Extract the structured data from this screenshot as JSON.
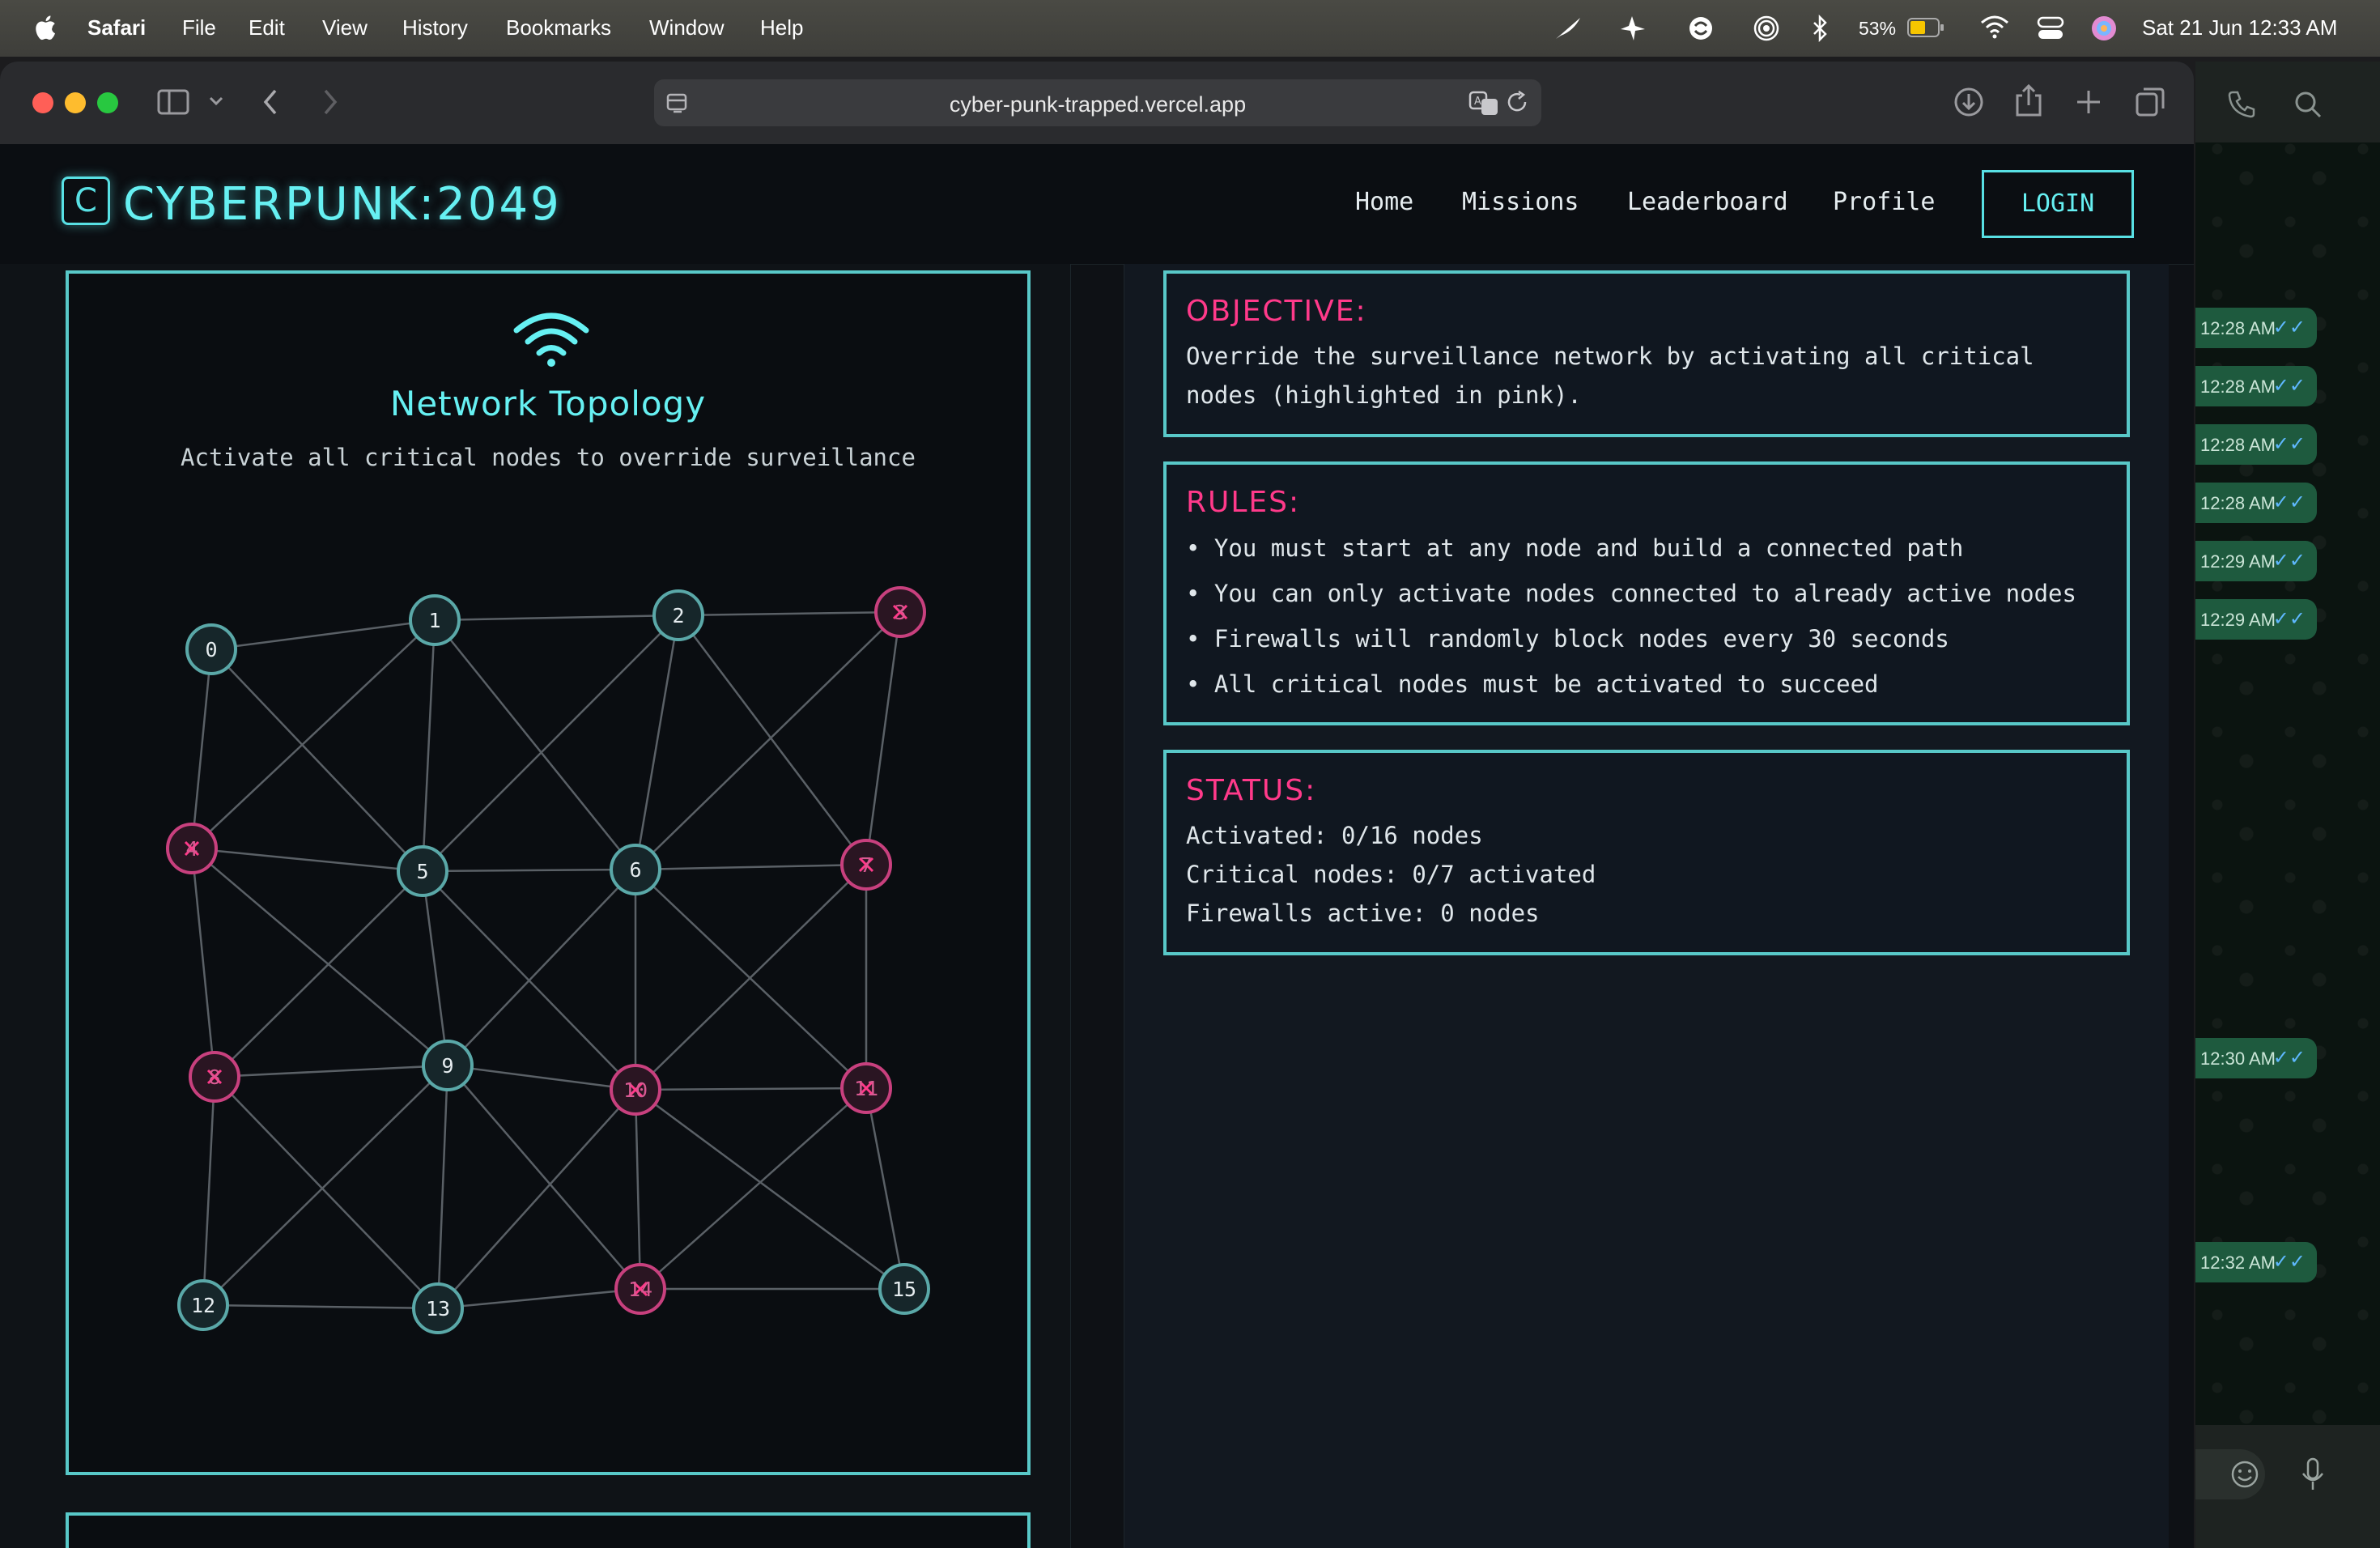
{
  "menubar": {
    "app": "Safari",
    "menus": [
      "File",
      "Edit",
      "View",
      "History",
      "Bookmarks",
      "Window",
      "Help"
    ],
    "battery": "53%",
    "datetime": "Sat 21 Jun  12:33 AM"
  },
  "browser": {
    "url": "cyber-punk-trapped.vercel.app"
  },
  "site": {
    "logo_letter": "C",
    "logo_text": "CYBERPUNK:2049",
    "nav": [
      "Home",
      "Missions",
      "Leaderboard",
      "Profile"
    ],
    "login": "LOGIN"
  },
  "network": {
    "title": "Network Topology",
    "subtitle": "Activate all critical nodes to override surveillance",
    "nodes": [
      {
        "id": "0",
        "critical": false
      },
      {
        "id": "1",
        "critical": false
      },
      {
        "id": "2",
        "critical": false
      },
      {
        "id": "3",
        "critical": true
      },
      {
        "id": "4",
        "critical": true
      },
      {
        "id": "5",
        "critical": false
      },
      {
        "id": "6",
        "critical": false
      },
      {
        "id": "7",
        "critical": true
      },
      {
        "id": "8",
        "critical": true
      },
      {
        "id": "9",
        "critical": false
      },
      {
        "id": "10",
        "critical": true
      },
      {
        "id": "11",
        "critical": true
      },
      {
        "id": "12",
        "critical": false
      },
      {
        "id": "13",
        "critical": false
      },
      {
        "id": "14",
        "critical": true
      },
      {
        "id": "15",
        "critical": false
      }
    ],
    "colors": {
      "normal": "#5aa8a8",
      "critical": "#c8407e",
      "edge": "#5a6066"
    }
  },
  "objective": {
    "heading": "OBJECTIVE:",
    "line1": "Override the surveillance network by activating all critical",
    "line2": "nodes (highlighted in pink)."
  },
  "rules": {
    "heading": "RULES:",
    "items": [
      "You must start at any node and build a connected path",
      "You can only activate nodes connected to already active nodes",
      "Firewalls will randomly block nodes every 30 seconds",
      "All critical nodes must be activated to succeed"
    ]
  },
  "status": {
    "heading": "STATUS:",
    "activated": "Activated: 0/16 nodes",
    "critical": "Critical nodes: 0/7 activated",
    "firewalls": "Firewalls active: 0 nodes"
  },
  "chat": {
    "times": [
      "12:28 AM",
      "12:28 AM",
      "12:28 AM",
      "12:28 AM",
      "12:29 AM",
      "12:29 AM",
      "12:30 AM",
      "12:32 AM"
    ]
  }
}
